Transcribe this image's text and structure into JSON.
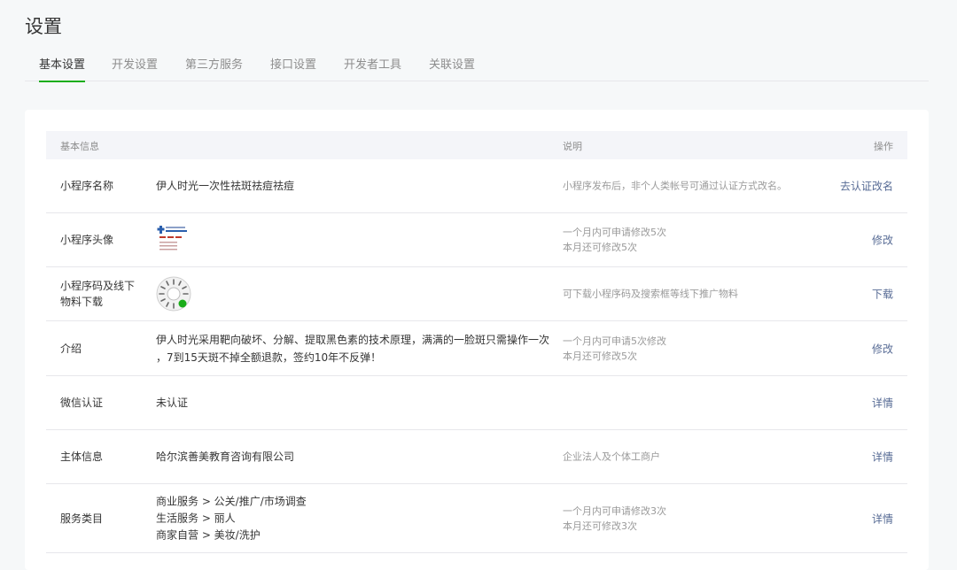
{
  "page": {
    "title": "设置"
  },
  "tabs": [
    {
      "label": "基本设置"
    },
    {
      "label": "开发设置"
    },
    {
      "label": "第三方服务"
    },
    {
      "label": "接口设置"
    },
    {
      "label": "开发者工具"
    },
    {
      "label": "关联设置"
    }
  ],
  "table": {
    "headers": {
      "info": "基本信息",
      "desc": "说明",
      "action": "操作"
    },
    "rows": [
      {
        "name": "小程序名称",
        "value": "伊人时光一次性祛斑祛痘祛痘",
        "desc": "小程序发布后，非个人类帐号可通过认证方式改名。",
        "action": "去认证改名"
      },
      {
        "name": "小程序头像",
        "image": "avatar-logo",
        "desc_1": "一个月内可申请修改5次",
        "desc_2": "本月还可修改5次",
        "action": "修改"
      },
      {
        "name": "小程序码及线下物料下载",
        "image": "mini-program-code",
        "desc": "可下载小程序码及搜索框等线下推广物料",
        "action": "下载"
      },
      {
        "name": "介绍",
        "value": "伊人时光采用靶向破坏、分解、提取黑色素的技术原理，满满的一脸斑只需操作一次 ，7到15天斑不掉全额退款，签约10年不反弹！",
        "desc_1": "一个月内可申请5次修改",
        "desc_2": "本月还可修改5次",
        "action": "修改"
      },
      {
        "name": "微信认证",
        "value": "未认证",
        "action": "详情"
      },
      {
        "name": "主体信息",
        "value": "哈尔滨善美教育咨询有限公司",
        "desc": "企业法人及个体工商户",
        "action": "详情"
      },
      {
        "name": "服务类目",
        "categories": [
          "商业服务 > 公关/推广/市场调查",
          "生活服务 > 丽人",
          "商家自营 > 美妆/洗护"
        ],
        "desc_1": "一个月内可申请修改3次",
        "desc_2": "本月还可修改3次",
        "action": "详情"
      }
    ]
  },
  "colors": {
    "accent": "#1aad19",
    "link": "#576b95",
    "muted": "#9a9a9a",
    "header_bg": "#f4f5f9"
  }
}
